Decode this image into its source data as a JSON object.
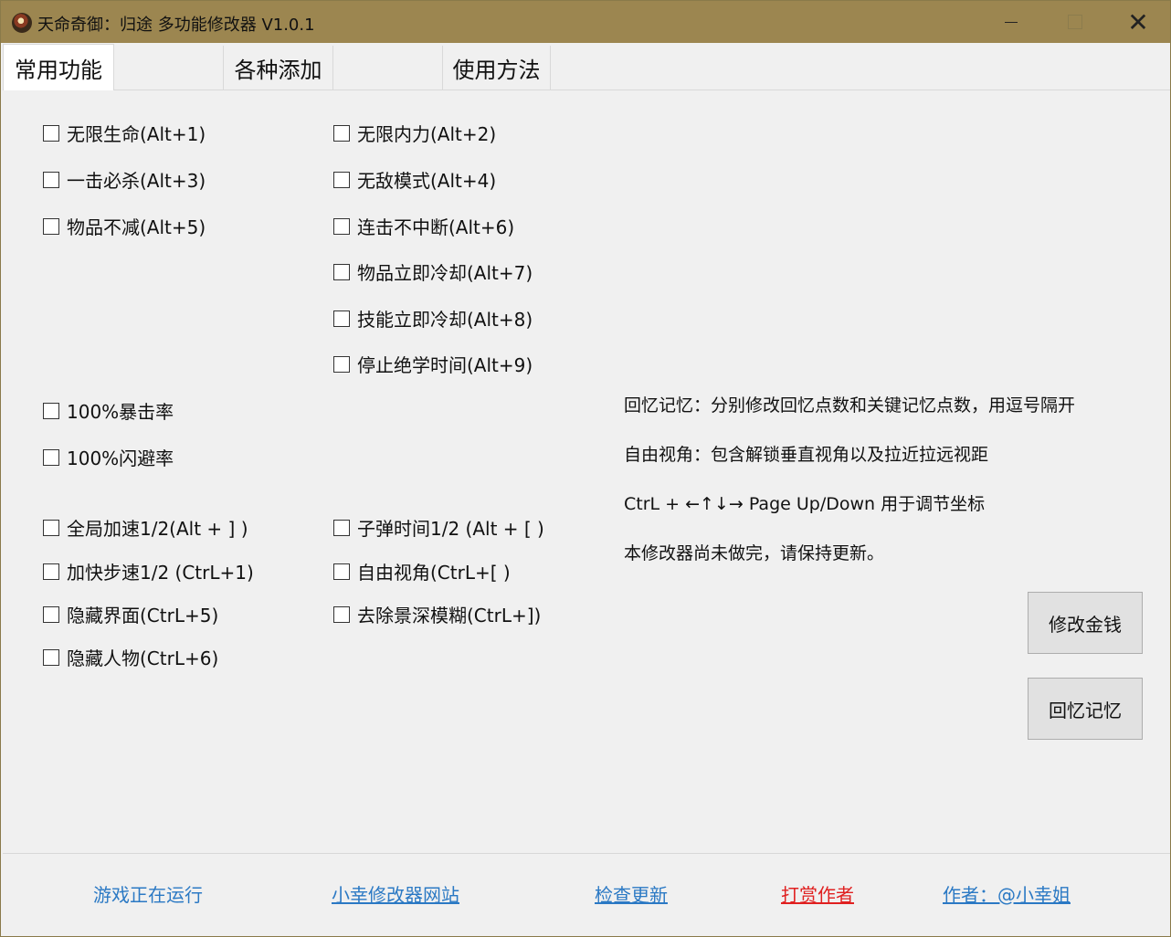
{
  "window": {
    "title": "天命奇御：归途 多功能修改器  V1.0.1",
    "controls": {
      "minimize_icon": "minimize-icon",
      "maximize_icon": "maximize-icon",
      "close_icon": "close-icon",
      "close_glyph": "✕"
    },
    "colors": {
      "titlebar": "#9c8650"
    }
  },
  "tabs": [
    {
      "label": "常用功能"
    },
    {
      "label": ""
    },
    {
      "label": "各种添加"
    },
    {
      "label": ""
    },
    {
      "label": "使用方法"
    }
  ],
  "checkboxes": {
    "left": [
      {
        "label": "无限生命(Alt+1)",
        "checked": false
      },
      {
        "label": "一击必杀(Alt+3)",
        "checked": false
      },
      {
        "label": "物品不减(Alt+5)",
        "checked": false
      },
      {
        "label": "100%暴击率",
        "checked": false
      },
      {
        "label": "100%闪避率",
        "checked": false
      },
      {
        "label": "全局加速1/2(Alt + ] )",
        "checked": false
      },
      {
        "label": "加快步速1/2 (CtrL+1)",
        "checked": false
      },
      {
        "label": "隐藏界面(CtrL+5)",
        "checked": false
      },
      {
        "label": "隐藏人物(CtrL+6)",
        "checked": false
      }
    ],
    "middle": [
      {
        "label": "无限内力(Alt+2)",
        "checked": false
      },
      {
        "label": "无敌模式(Alt+4)",
        "checked": false
      },
      {
        "label": "连击不中断(Alt+6)",
        "checked": false
      },
      {
        "label": "物品立即冷却(Alt+7)",
        "checked": false
      },
      {
        "label": "技能立即冷却(Alt+8)",
        "checked": false
      },
      {
        "label": "停止绝学时间(Alt+9)",
        "checked": false
      },
      {
        "label": "子弹时间1/2 (Alt + [ )",
        "checked": false
      },
      {
        "label": "自由视角(CtrL+[ )",
        "checked": false
      },
      {
        "label": "去除景深模糊(CtrL+])",
        "checked": false
      }
    ]
  },
  "info_lines": [
    "回忆记忆：分别修改回忆点数和关键记忆点数，用逗号隔开",
    "自由视角：包含解锁垂直视角以及拉近拉远视距",
    "CtrL + ←↑↓→ Page Up/Down 用于调节坐标",
    "本修改器尚未做完，请保持更新。"
  ],
  "buttons": [
    {
      "label": "修改金钱"
    },
    {
      "label": "回忆记忆"
    }
  ],
  "footer": [
    {
      "label": "游戏正在运行",
      "color": "#2b79c4"
    },
    {
      "label": "小幸修改器网站",
      "color": "#2b79c4"
    },
    {
      "label": "检查更新",
      "color": "#2b79c4"
    },
    {
      "label": "打赏作者",
      "color": "#e02020"
    },
    {
      "label": "作者：@小幸姐",
      "color": "#2b79c4"
    }
  ]
}
